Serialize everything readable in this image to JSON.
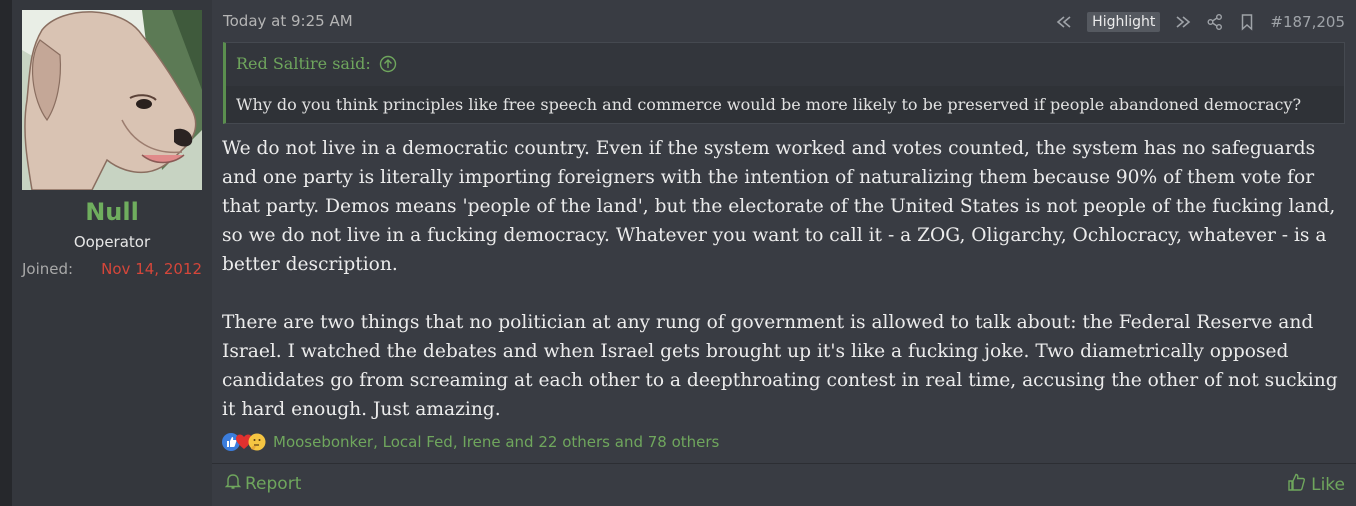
{
  "author": {
    "username": "Null",
    "title": "Ooperator",
    "joined_label": "Joined:",
    "joined_value": "Nov 14, 2012"
  },
  "post": {
    "date": "Today at 9:25 AM",
    "highlight_label": "Highlight",
    "number": "#187,205",
    "quote": {
      "attribution": "Red Saltire said:",
      "text": "Why do you think principles like free speech and commerce would be more likely to be preserved if people abandoned democracy?"
    },
    "paragraphs": [
      "We do not live in a democratic country. Even if the system worked and votes counted, the system has no safeguards and one party is literally importing foreigners with the intention of naturalizing them because 90% of them vote for that party. Demos means 'people of the land', but the electorate of the United States is not people of the fucking land, so we do not live in a fucking democracy. Whatever you want to call it - a ZOG, Oligarchy, Ochlocracy, whatever - is a better description.",
      "There are two things that no politician at any rung of government is allowed to talk about: the Federal Reserve and Israel. I watched the debates and when Israel gets brought up it's like a fucking joke. Two diametrically opposed candidates go from screaming at each other to a deepthroating contest in real time, accusing the other of not sucking it hard enough. Just amazing."
    ],
    "reactions_text": "Moosebonker, Local Fed, Irene and 22 others and 78 others",
    "reaction_icons": [
      "thumbs-up-icon",
      "heart-icon",
      "thinking-face-icon"
    ],
    "report_label": "Report",
    "like_label": "Like"
  },
  "colors": {
    "accent_green": "#6fa65d",
    "joined_red": "#d4463a",
    "background": "#393c43"
  }
}
